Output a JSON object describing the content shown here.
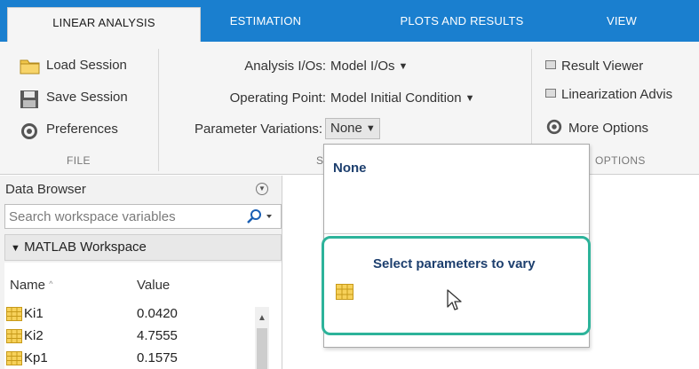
{
  "tabs": [
    {
      "label": "LINEAR ANALYSIS",
      "active": true
    },
    {
      "label": "ESTIMATION",
      "active": false
    },
    {
      "label": "PLOTS AND RESULTS",
      "active": false
    },
    {
      "label": "VIEW",
      "active": false
    }
  ],
  "ribbon": {
    "file": {
      "load_session": "Load Session",
      "save_session": "Save Session",
      "preferences": "Preferences",
      "group_label": "FILE"
    },
    "setup": {
      "analysis_ios_label": "Analysis I/Os:",
      "analysis_ios_value": "Model I/Os",
      "operating_point_label": "Operating Point:",
      "operating_point_value": "Model Initial Condition",
      "param_variations_label": "Parameter Variations:",
      "param_variations_value": "None",
      "group_label": "S"
    },
    "options": {
      "result_viewer": "Result Viewer",
      "linearization_advisor": "Linearization Advis",
      "more_options": "More Options",
      "group_label": "OPTIONS"
    }
  },
  "data_browser": {
    "title": "Data Browser",
    "search_placeholder": "Search workspace variables",
    "workspace_header": "MATLAB Workspace",
    "columns": {
      "name": "Name",
      "value": "Value"
    },
    "sort_indicator": "^",
    "rows": [
      {
        "name": "Ki1",
        "value": "0.0420"
      },
      {
        "name": "Ki2",
        "value": "4.7555"
      },
      {
        "name": "Kp1",
        "value": "0.1575"
      }
    ]
  },
  "popup": {
    "none_option": "None",
    "select_option": "Select parameters to vary"
  },
  "colors": {
    "tab_bar": "#1a7fcf",
    "highlight": "#2db39a",
    "popup_text": "#1d3f6e"
  }
}
